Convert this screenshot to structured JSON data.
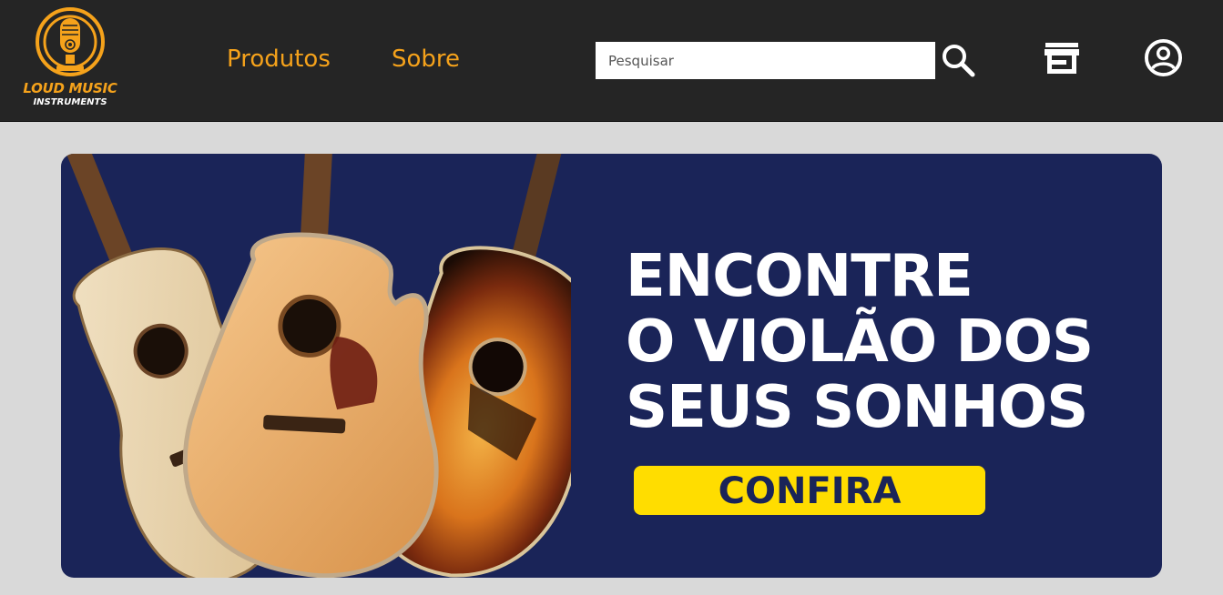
{
  "header": {
    "logo": {
      "line1": "LOUD MUSIC",
      "line2": "INSTRUMENTS",
      "icon": "microphone-icon"
    },
    "nav": [
      {
        "label": "Produtos"
      },
      {
        "label": "Sobre"
      }
    ],
    "search": {
      "placeholder": "Pesquisar",
      "icon": "search-icon"
    },
    "store_icon": "store-icon",
    "account_icon": "user-account-icon"
  },
  "banner": {
    "headline": [
      "ENCONTRE",
      "O VIOLÃO DOS",
      "SEUS SONHOS"
    ],
    "cta_label": "CONFIRA",
    "image": "acoustic-guitars-image"
  },
  "colors": {
    "header_bg": "#252525",
    "accent": "#f5a21b",
    "banner_bg": "#1a2458",
    "cta_bg": "#ffdd00",
    "page_bg": "#d9d9d9"
  }
}
